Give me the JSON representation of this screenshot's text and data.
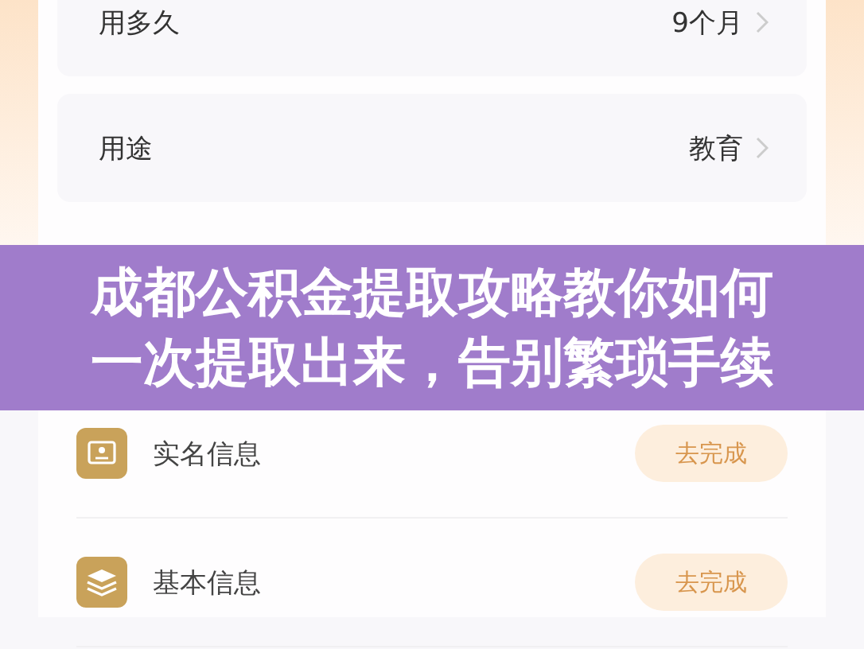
{
  "form_rows": [
    {
      "label": "用多久",
      "value": "9个月"
    },
    {
      "label": "用途",
      "value": "教育"
    }
  ],
  "banner": {
    "lines": [
      "成都公积金提取攻略教你如何",
      "一次提取出来，告别繁琐手续"
    ]
  },
  "tasks": [
    {
      "kind": "id-card",
      "label": "实名信息",
      "action": "去完成"
    },
    {
      "kind": "layers",
      "label": "基本信息",
      "action": "去完成"
    }
  ]
}
